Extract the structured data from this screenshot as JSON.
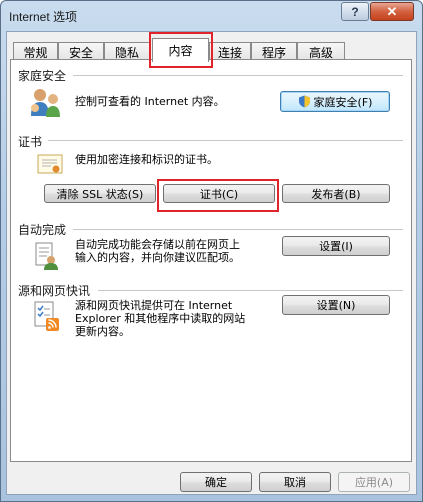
{
  "window": {
    "title": "Internet 选项",
    "help_glyph": "?",
    "close_glyph": "✕"
  },
  "tabs": [
    {
      "label": "常规"
    },
    {
      "label": "安全"
    },
    {
      "label": "隐私"
    },
    {
      "label": "内容"
    },
    {
      "label": "连接"
    },
    {
      "label": "程序"
    },
    {
      "label": "高级"
    }
  ],
  "active_tab": "内容",
  "family_safety": {
    "title": "家庭安全",
    "description": "控制可查看的 Internet 内容。",
    "button_label": "家庭安全(F)"
  },
  "certificates": {
    "title": "证书",
    "description": "使用加密连接和标识的证书。",
    "clear_ssl_label": "清除 SSL 状态(S)",
    "certificates_label": "证书(C)",
    "publishers_label": "发布者(B)"
  },
  "autocomplete": {
    "title": "自动完成",
    "description_line1": "自动完成功能会存储以前在网页上",
    "description_line2": "输入的内容，并向你建议匹配项。",
    "settings_label": "设置(I)"
  },
  "feeds": {
    "title": "源和网页快讯",
    "description_line1": "源和网页快讯提供可在 Internet",
    "description_line2": "Explorer 和其他程序中读取的网站",
    "description_line3": "更新内容。",
    "settings_label": "设置(N)"
  },
  "footer": {
    "ok_label": "确定",
    "cancel_label": "取消",
    "apply_label": "应用(A)"
  },
  "colors": {
    "highlight": "#e0242b",
    "title_bar": "#b5cde6"
  }
}
